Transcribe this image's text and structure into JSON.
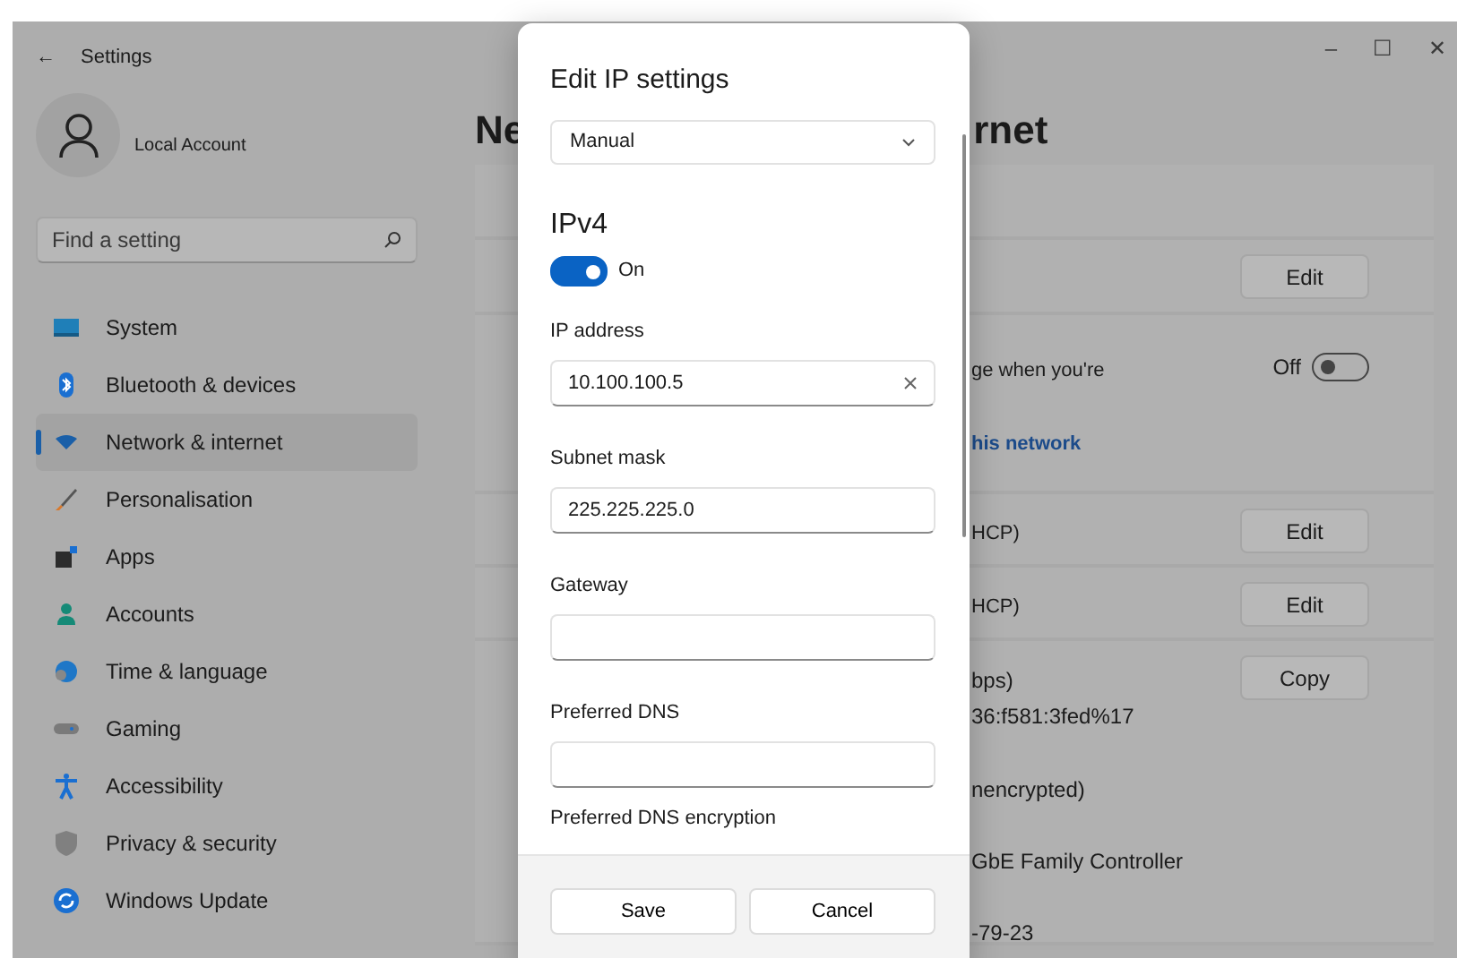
{
  "window": {
    "back": "←",
    "title": "Settings",
    "controls": [
      "–",
      "☐",
      "✕"
    ]
  },
  "account": {
    "name": "Local Account"
  },
  "search": {
    "placeholder": "Find a setting"
  },
  "nav": [
    {
      "label": "System",
      "selected": false
    },
    {
      "label": "Bluetooth & devices",
      "selected": false
    },
    {
      "label": "Network & internet",
      "selected": true
    },
    {
      "label": "Personalisation",
      "selected": false
    },
    {
      "label": "Apps",
      "selected": false
    },
    {
      "label": "Accounts",
      "selected": false
    },
    {
      "label": "Time & language",
      "selected": false
    },
    {
      "label": "Gaming",
      "selected": false
    },
    {
      "label": "Accessibility",
      "selected": false
    },
    {
      "label": "Privacy & security",
      "selected": false
    },
    {
      "label": "Windows Update",
      "selected": false
    }
  ],
  "page": {
    "heading_parts": [
      "Ne",
      "rnet"
    ],
    "rows": [
      {
        "lines": []
      },
      {
        "lines": [],
        "action": {
          "kind": "button",
          "label": "Edit"
        }
      },
      {
        "lines": [
          {
            "text": "ge when you're",
            "kind": "text"
          },
          {
            "text": "his network",
            "kind": "link"
          }
        ],
        "action": {
          "kind": "toggle",
          "label": "Off",
          "on": false
        }
      },
      {
        "lines": [
          {
            "text": "HCP)",
            "kind": "text"
          }
        ],
        "action": {
          "kind": "button",
          "label": "Edit"
        }
      },
      {
        "lines": [
          {
            "text": "HCP)",
            "kind": "text"
          }
        ],
        "action": {
          "kind": "button",
          "label": "Edit"
        }
      },
      {
        "lines": [
          {
            "text": "bps)",
            "kind": "text"
          },
          {
            "text": "36:f581:3fed%17",
            "kind": "text"
          },
          {
            "text": "nencrypted)",
            "kind": "text"
          },
          {
            "text": "GbE Family Controller",
            "kind": "text"
          },
          {
            "text": "-79-23",
            "kind": "text"
          }
        ],
        "action": {
          "kind": "button",
          "label": "Copy"
        }
      }
    ]
  },
  "dialog": {
    "title": "Edit IP settings",
    "mode": "Manual",
    "section": "IPv4",
    "toggle": {
      "label": "On",
      "on": true
    },
    "fields": [
      {
        "label": "IP address",
        "value": "10.100.100.5",
        "clear_button": true
      },
      {
        "label": "Subnet mask",
        "value": "225.225.225.0",
        "clear_button": false
      },
      {
        "label": "Gateway",
        "clear_button": false
      },
      {
        "label": "Preferred DNS",
        "clear_button": false
      }
    ],
    "trailing_label": "Preferred DNS encryption",
    "buttons": [
      "Save",
      "Cancel"
    ]
  }
}
